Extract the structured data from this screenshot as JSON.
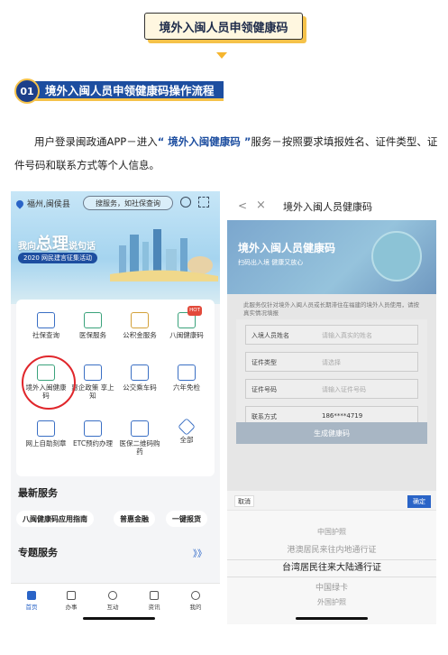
{
  "title_banner": "境外入闽人员申领健康码",
  "section": {
    "number": "01",
    "title": "境外入闽人员申领健康码操作流程"
  },
  "paragraph": {
    "before": "用户登录闽政通APP－进入",
    "highlight": "“ 境外入闽健康码 ”",
    "after": "服务－按照要求填报姓名、证件类型、证件号码和联系方式等个人信息。"
  },
  "left_phone": {
    "location": "福州,闽侯县",
    "search_placeholder": "搜服务，如社保查询",
    "slogan_a": "我向",
    "slogan_b": "总理",
    "slogan_c": "说句话",
    "campaign_tag": "2020 网民建言征集活动",
    "hot_badge": "HOT",
    "grid": [
      {
        "label": "社保查询",
        "icon": "shield-icon"
      },
      {
        "label": "医保服务",
        "icon": "medical-shield-icon"
      },
      {
        "label": "公积金服务",
        "icon": "house-fund-icon"
      },
      {
        "label": "八闽健康码",
        "icon": "qr-health-icon"
      },
      {
        "label": "境外入闽健康码",
        "icon": "qr-globe-icon"
      },
      {
        "label": "惠企政策 享上知",
        "icon": "policy-doc-icon"
      },
      {
        "label": "公交乘车码",
        "icon": "bus-qr-icon"
      },
      {
        "label": "六年免检",
        "icon": "car-icon"
      },
      {
        "label": "网上自助刻章",
        "icon": "stamp-icon"
      },
      {
        "label": "ETC预约办理",
        "icon": "etc-icon"
      },
      {
        "label": "医保二维码购药",
        "icon": "medicine-qr-icon"
      },
      {
        "label": "全部",
        "icon": "all-diamond-icon"
      }
    ],
    "news_title": "最新服务",
    "chips": [
      "八闽健康码应用指南",
      "普惠金融",
      "一键报货"
    ],
    "topic_title": "专题服务",
    "more": "》》",
    "tabs": [
      {
        "label": "首页",
        "icon": "home-icon"
      },
      {
        "label": "办事",
        "icon": "handle-icon"
      },
      {
        "label": "互动",
        "icon": "chat-icon"
      },
      {
        "label": "资讯",
        "icon": "news-icon"
      },
      {
        "label": "我的",
        "icon": "person-icon"
      }
    ]
  },
  "right_phone": {
    "nav_back": "<",
    "nav_close": "×",
    "nav_title": "境外入闽人员健康码",
    "banner_title": "境外入闽人员健康码",
    "banner_sub": "扫码出入境 健康又放心",
    "notice": "此服务仅针对境外入闽人员或长期滞住在福建的境外人员使用，请按真实情况填报",
    "form": [
      {
        "label": "入境人员姓名",
        "value": "请输入真实的姓名",
        "dark": false
      },
      {
        "label": "证件类型",
        "value": "请选择",
        "dark": false
      },
      {
        "label": "证件号码",
        "value": "请输入证件号码",
        "dark": false
      },
      {
        "label": "联系方式",
        "value": "186****4719",
        "dark": true
      }
    ],
    "submit": "生成健康码",
    "picker_cancel": "取消",
    "picker_ok": "确定",
    "picker_options": [
      "中国护照",
      "港澳居民来往内地通行证",
      "台湾居民往来大陆通行证",
      "中国绿卡",
      "外国护照"
    ],
    "picker_selected_index": 2
  }
}
